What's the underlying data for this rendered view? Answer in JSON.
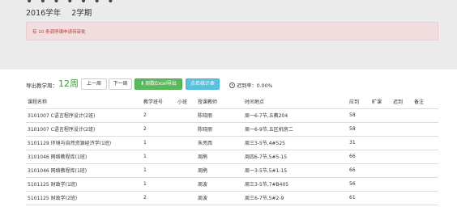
{
  "header": {
    "term_year": "2016学年",
    "term_semester": "2学期"
  },
  "alert": {
    "text": "有 10 条调停课申请待审批"
  },
  "toolbar": {
    "week_label": "导出教学周：",
    "week_value": "12周",
    "prev_label": "上一周",
    "next_label": "下一周",
    "export_label": "周数Excel导出",
    "stats_label": "点名统计表",
    "late_rate_label": "迟到率：0.00%"
  },
  "table": {
    "headers": [
      "课程名称",
      "教学班号",
      "小班",
      "授课教师",
      "时间地点",
      "应到",
      "旷课",
      "迟到",
      "备注"
    ],
    "rows": [
      [
        "3101007 C语言程序设计(2班)",
        "2",
        "",
        "陈晓丽",
        "周一6-7节,五教204",
        "58",
        "",
        "",
        ""
      ],
      [
        "3101007 C语言程序设计(2班)",
        "2",
        "",
        "陈晓丽",
        "周一6-9节,五区机房二",
        "58",
        "",
        "",
        ""
      ],
      [
        "5101129 环境与自然资源经济学(1班)",
        "1",
        "",
        "朱亮西",
        "周三3-5节,4#525",
        "31",
        "",
        "",
        ""
      ],
      [
        "3101046 网络教程库(1班)",
        "1",
        "",
        "周鹃",
        "周四6-7节,5#5-15",
        "66",
        "",
        "",
        ""
      ],
      [
        "3101046 网络教程库(1班)",
        "1",
        "",
        "周鹃",
        "周一3-5节,5#1-15",
        "66",
        "",
        "",
        ""
      ],
      [
        "5101125 财政学(1班)",
        "1",
        "",
        "周波",
        "周三3-5节,7#B405",
        "56",
        "",
        "",
        ""
      ],
      [
        "5101125 财政学(2班)",
        "2",
        "",
        "周波",
        "周三6-7节,5#2-9",
        "61",
        "",
        "",
        ""
      ]
    ]
  }
}
